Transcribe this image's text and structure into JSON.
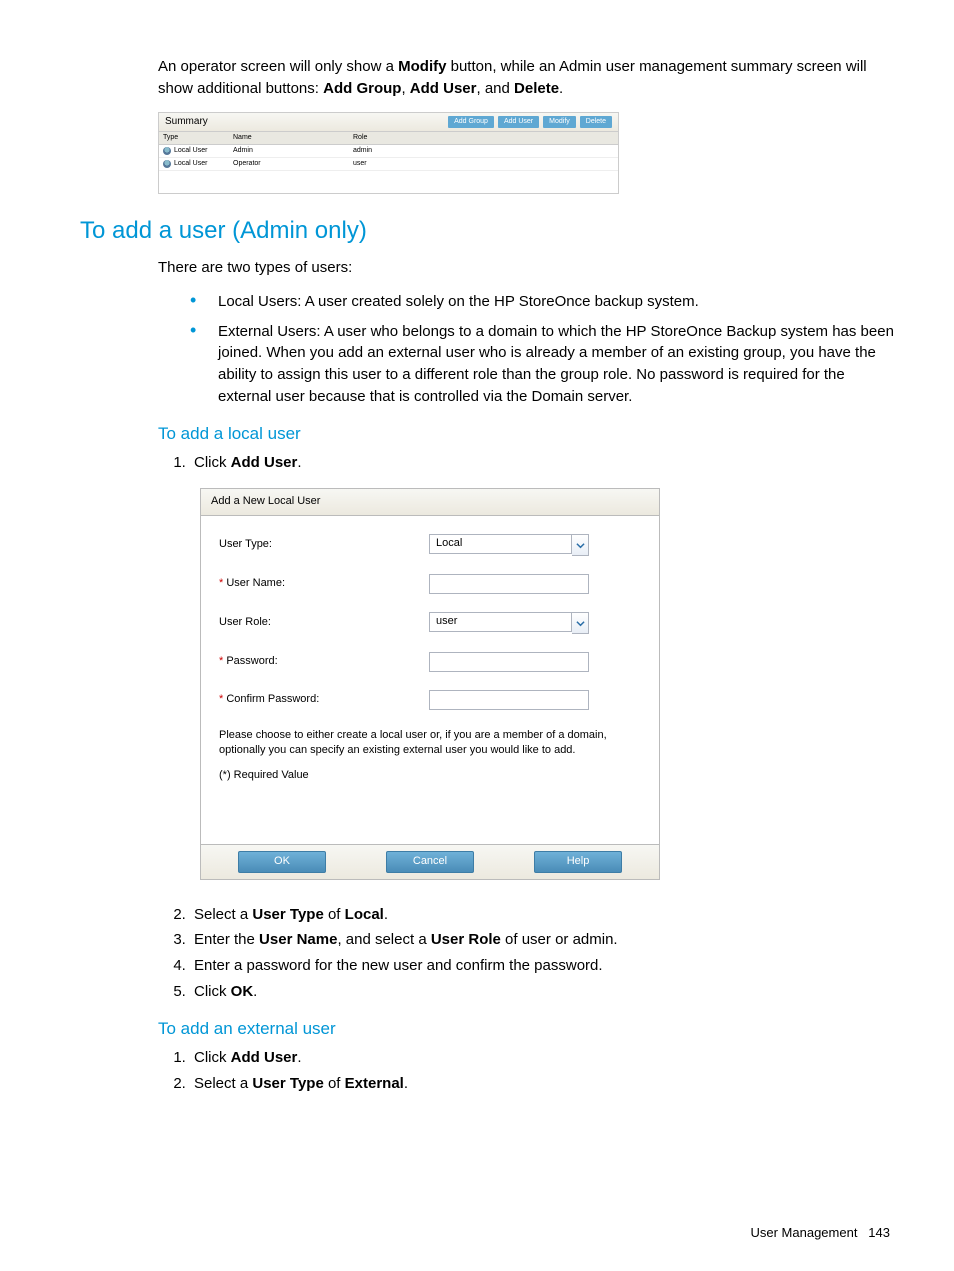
{
  "intro": {
    "part1": "An operator screen will only show a ",
    "modify": "Modify",
    "part2": " button, while an Admin user management summary screen will show additional buttons: ",
    "b1": "Add Group",
    "b2": "Add User",
    "and": ", and ",
    "b3": "Delete",
    "end": "."
  },
  "summary": {
    "title": "Summary",
    "buttons": [
      "Add Group",
      "Add User",
      "Modify",
      "Delete"
    ],
    "headers": [
      "Type",
      "Name",
      "Role"
    ],
    "rows": [
      {
        "type": "Local User",
        "name": "Admin",
        "role": "admin"
      },
      {
        "type": "Local User",
        "name": "Operator",
        "role": "user"
      }
    ]
  },
  "sections": {
    "add_user_admin": "To add a user (Admin only)",
    "two_types": "There are two types of users:",
    "local_bullet": "Local Users: A user created solely on the HP StoreOnce backup system.",
    "external_bullet": "External Users: A user who belongs to a domain to which the HP StoreOnce Backup system has been joined. When you add an external user who is already a member of an existing group, you have the ability to assign this user to a different role than the group role. No password is required for the external user because that is controlled via the Domain server.",
    "add_local": "To add a local user",
    "add_external": "To add an external user"
  },
  "steps_local": {
    "s1a": "Click ",
    "s1b": "Add User",
    "s1c": ".",
    "s2a": "Select a ",
    "s2b": "User Type",
    "s2c": " of ",
    "s2d": "Local",
    "s2e": ".",
    "s3a": "Enter the ",
    "s3b": "User Name",
    "s3c": ", and select a ",
    "s3d": "User Role",
    "s3e": " of user or admin.",
    "s4": "Enter a password for the new user and confirm the password.",
    "s5a": "Click ",
    "s5b": "OK",
    "s5c": "."
  },
  "steps_ext": {
    "s1a": "Click ",
    "s1b": "Add User",
    "s1c": ".",
    "s2a": "Select a ",
    "s2b": "User Type",
    "s2c": " of ",
    "s2d": "External",
    "s2e": "."
  },
  "dialog": {
    "title": "Add a New Local User",
    "labels": {
      "user_type": "User Type:",
      "user_name": "User Name:",
      "user_role": "User Role:",
      "password": "Password:",
      "confirm": "Confirm Password:"
    },
    "values": {
      "user_type": "Local",
      "user_role": "user"
    },
    "helper": "Please choose to either create a local user or, if you are a member of a domain, optionally you can specify an existing external user you would like to add.",
    "required": "(*) Required Value",
    "ok": "OK",
    "cancel": "Cancel",
    "help": "Help"
  },
  "footer": {
    "label": "User Management",
    "page": "143"
  }
}
